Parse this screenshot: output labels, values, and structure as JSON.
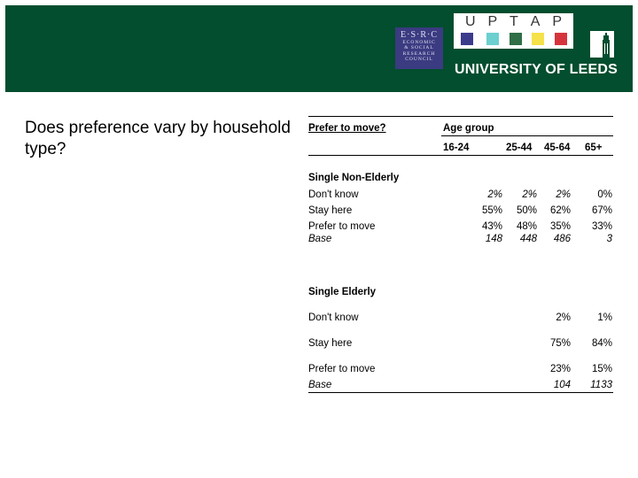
{
  "banner": {
    "esrc": {
      "acronym": "E·S·R·C",
      "lines": [
        "ECONOMIC",
        "& SOCIAL",
        "RESEARCH",
        "COUNCIL"
      ]
    },
    "uptap": {
      "letters": [
        "U",
        "P",
        "T",
        "A",
        "P"
      ],
      "colors": [
        "#3b3b8c",
        "#6ccfd0",
        "#2f6e46",
        "#f5e14a",
        "#d6343c"
      ]
    },
    "university": "UNIVERSITY OF LEEDS",
    "brand_color": "#024e2e"
  },
  "question": "Does preference vary by household type?",
  "table": {
    "row_header": "Prefer to move?",
    "column_group": "Age group",
    "columns": [
      "16-24",
      "25-44",
      "45-64",
      "65+"
    ],
    "sections": [
      {
        "title": "Single Non-Elderly",
        "rows": [
          {
            "label": "Don't know",
            "values": [
              "2%",
              "2%",
              "2%",
              "0%"
            ]
          },
          {
            "label": "Stay here",
            "values": [
              "55%",
              "50%",
              "62%",
              "67%"
            ]
          },
          {
            "label": "Prefer to move",
            "values": [
              "43%",
              "48%",
              "35%",
              "33%"
            ]
          }
        ],
        "base": {
          "label": "Base",
          "values": [
            "148",
            "448",
            "486",
            "3"
          ]
        }
      },
      {
        "title": "Single Elderly",
        "rows": [
          {
            "label": "Don't know",
            "values": [
              "",
              "",
              "2%",
              "1%"
            ]
          },
          {
            "label": "Stay here",
            "values": [
              "",
              "",
              "75%",
              "84%"
            ]
          },
          {
            "label": "Prefer to move",
            "values": [
              "",
              "",
              "23%",
              "15%"
            ]
          }
        ],
        "base": {
          "label": "Base",
          "values": [
            "",
            "",
            "104",
            "1133"
          ]
        }
      }
    ]
  }
}
